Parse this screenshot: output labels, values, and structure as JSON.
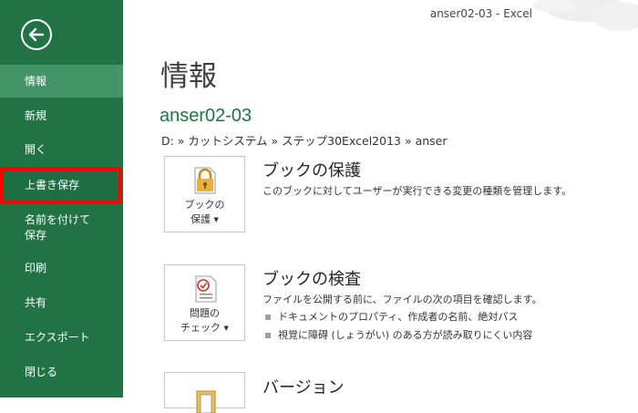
{
  "window": {
    "title": "anser02-03 - Excel"
  },
  "sidebar": {
    "items": [
      {
        "label": "情報"
      },
      {
        "label": "新規"
      },
      {
        "label": "開く"
      },
      {
        "label": "上書き保存"
      },
      {
        "label": "名前を付けて\n保存"
      },
      {
        "label": "印刷"
      },
      {
        "label": "共有"
      },
      {
        "label": "エクスポート"
      },
      {
        "label": "閉じる"
      }
    ]
  },
  "main": {
    "title": "情報",
    "file_name": "anser02-03",
    "path": "D: » カットシステム » ステップ30Excel2013 » anser",
    "sections": [
      {
        "button_line1": "ブックの",
        "button_line2": "保護",
        "title": "ブックの保護",
        "description": "このブックに対してユーザーが実行できる変更の種類を管理します。"
      },
      {
        "button_line1": "問題の",
        "button_line2": "チェック",
        "title": "ブックの検査",
        "description": "ファイルを公開する前に、ファイルの次の項目を確認します。",
        "bullets": [
          "ドキュメントのプロパティ、作成者の名前、絶対パス",
          "視覚に障碍 (しょうがい) のある方が読み取りにくい内容"
        ]
      },
      {
        "title": "バージョン"
      }
    ]
  },
  "colors": {
    "accent": "#217346",
    "active_item": "#439467",
    "highlight_border": "#ff0000"
  },
  "icons": [
    "back-arrow-icon",
    "lock-document-icon",
    "inspect-document-icon",
    "versions-document-icon",
    "dropdown-caret-icon"
  ]
}
